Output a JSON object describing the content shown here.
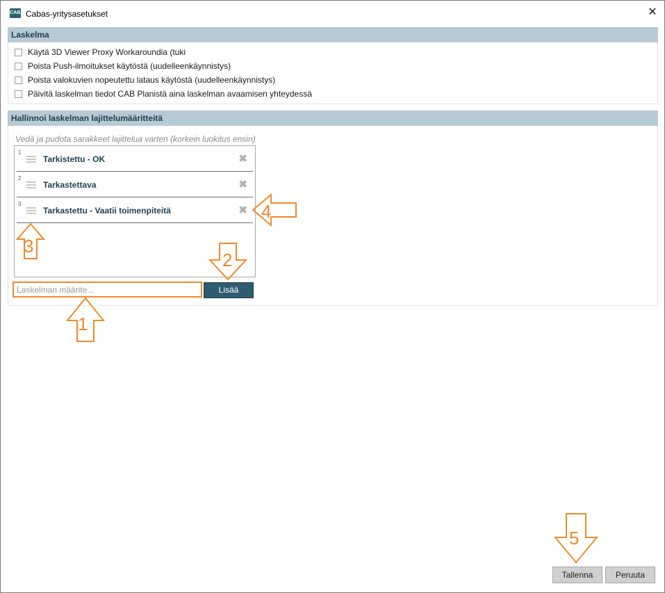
{
  "window": {
    "title": "Cabas-yritysasetukset",
    "app_icon_text": "CAB",
    "close_glyph": "✕"
  },
  "section_calc": {
    "header": "Laskelma",
    "options": [
      {
        "label": "Käytä 3D Viewer Proxy Workaroundia (tuki",
        "checked": false
      },
      {
        "label": "Poista Push-ilmoitukset käytöstä (uudelleenkäynnistys)",
        "checked": false
      },
      {
        "label": "Poista valokuvien nopeutettu lataus käytöstä (uudelleenkäynnistys)",
        "checked": false
      },
      {
        "label": "Päivitä laskelman tiedot CAB Planistä aina laskelman avaamisen yhteydessä",
        "checked": false
      }
    ]
  },
  "section_sort": {
    "header": "Hallinnoi laskelman lajittelumääritteitä",
    "hint": "Vedä ja pudota sarakkeet lajittelua varten (korkein luokitus ensin)",
    "items": [
      {
        "num": "1",
        "label": "Tarkistettu - OK"
      },
      {
        "num": "2",
        "label": "Tarkastettava"
      },
      {
        "num": "3",
        "label": "Tarkastettu - Vaatii toimenpiteitä"
      }
    ],
    "remove_glyph": "✖",
    "input_placeholder": "Laskelman määrite...",
    "add_label": "Lisää"
  },
  "footer": {
    "save_label": "Tallenna",
    "cancel_label": "Peruuta"
  },
  "callouts": [
    "1",
    "2",
    "3",
    "4",
    "5"
  ],
  "colors": {
    "accent": "#f08a2c",
    "header_bg": "#b8cad4",
    "primary_button": "#2e5b6e"
  }
}
